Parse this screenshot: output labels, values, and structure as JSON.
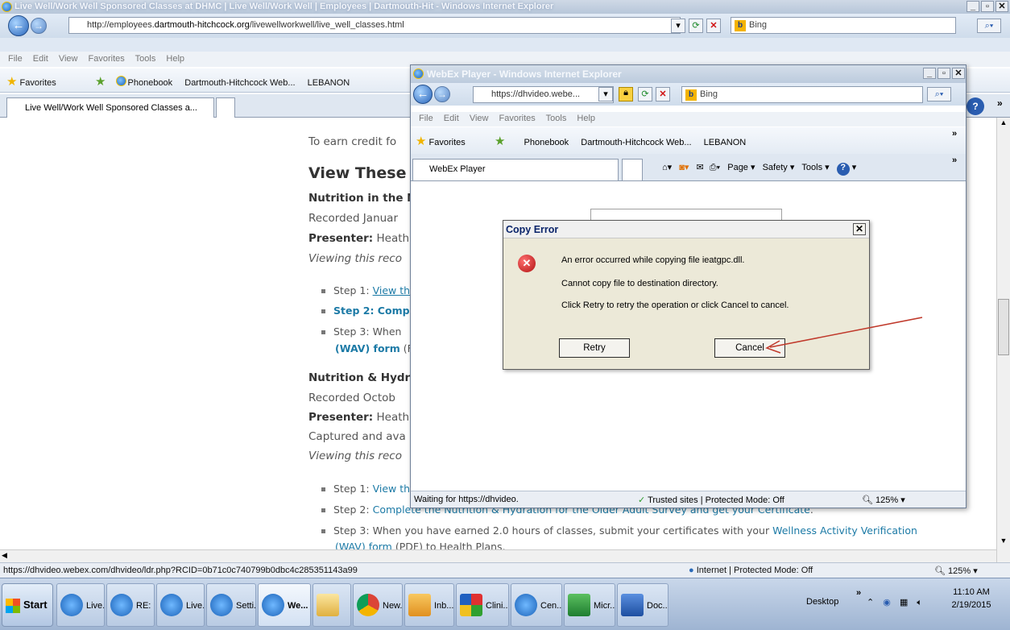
{
  "browser": {
    "title": "Live Well/Work Well Sponsored Classes at DHMC | Live Well/Work Well | Employees | Dartmouth-Hit - Windows Internet Explorer",
    "url_prefix": "http://employees.",
    "url_domain": "dartmouth-hitchcock.org",
    "url_path": "/livewellworkwell/live_well_classes.html",
    "search_placeholder": "Bing",
    "menu": [
      "File",
      "Edit",
      "View",
      "Favorites",
      "Tools",
      "Help"
    ],
    "favorites_label": "Favorites",
    "favorites_items": [
      "Phonebook",
      "Dartmouth-Hitchcock Web...",
      "LEBANON"
    ],
    "tab_label": "Live Well/Work Well Sponsored Classes a...",
    "status_url": "https://dhvideo.webex.com/dhvideo/ldr.php?RCID=0b71c0c740799b0dbc4c285351143a99",
    "status_zone": "Internet | Protected Mode: Off",
    "zoom": "125%"
  },
  "page": {
    "intro": "To earn credit fo",
    "heading": "View These Re",
    "section1": {
      "title": "Nutrition in the N",
      "recorded": "Recorded Januar",
      "presenter_label": "Presenter:",
      "presenter": "Heath",
      "viewing": "Viewing this reco",
      "step1_prefix": "Step 1:",
      "step1_link": "View th",
      "step2": "Step 2: Comp",
      "step3_prefix": "Step 3: When",
      "step3_link": "(WAV) form",
      "step3_suffix": "(F"
    },
    "section2": {
      "title": "Nutrition & Hydr",
      "recorded": "Recorded Octob",
      "presenter_label": "Presenter:",
      "presenter": "Heath",
      "captured": "Captured and ava",
      "viewing": "Viewing this reco",
      "step1_prefix": "Step 1:",
      "step1_link": "View th",
      "step2_prefix": "Step 2:",
      "step2_link": "Complete the Nutrition & Hydration for the Older Adult Survey and get your Certificate",
      "step2_suffix": ".",
      "step3_text": "Step 3: When you have earned 2.0 hours of classes, submit your certificates with your",
      "step3_link": "Wellness Activity Verification",
      "step3_link2": "(WAV) form",
      "step3_suffix": "(PDF) to Health Plans."
    }
  },
  "webex": {
    "title": "WebEx Player - Windows Internet Explorer",
    "url": "https://dhvideo.webe...",
    "search_placeholder": "Bing",
    "menu": [
      "File",
      "Edit",
      "View",
      "Favorites",
      "Tools",
      "Help"
    ],
    "favorites_label": "Favorites",
    "favorites_items": [
      "Phonebook",
      "Dartmouth-Hitchcock Web...",
      "LEBANON"
    ],
    "tab_label": "WebEx Player",
    "cmd_page": "Page",
    "cmd_safety": "Safety",
    "cmd_tools": "Tools",
    "status_waiting": "Waiting for https://dhvideo.",
    "status_zone": "Trusted sites | Protected Mode: Off",
    "zoom": "125%"
  },
  "dialog": {
    "title": "Copy Error",
    "line1": "An error occurred while copying file ieatgpc.dll.",
    "line2": "Cannot copy file to destination directory.",
    "line3": "Click Retry to retry the operation or click Cancel to cancel.",
    "retry": "Retry",
    "cancel": "Cancel"
  },
  "taskbar": {
    "start": "Start",
    "items": [
      "Live...",
      "RE: ...",
      "Live...",
      "Setti...",
      "We...",
      "",
      "New...",
      "Inb...",
      "Clini...",
      "Cen...",
      "Micr...",
      "Doc..."
    ],
    "desktop": "Desktop",
    "time": "11:10 AM",
    "date": "2/19/2015"
  },
  "colors": {
    "link": "#1c7aa6",
    "annotation_arrow": "#c0392b",
    "error_icon": "#cc2222"
  }
}
